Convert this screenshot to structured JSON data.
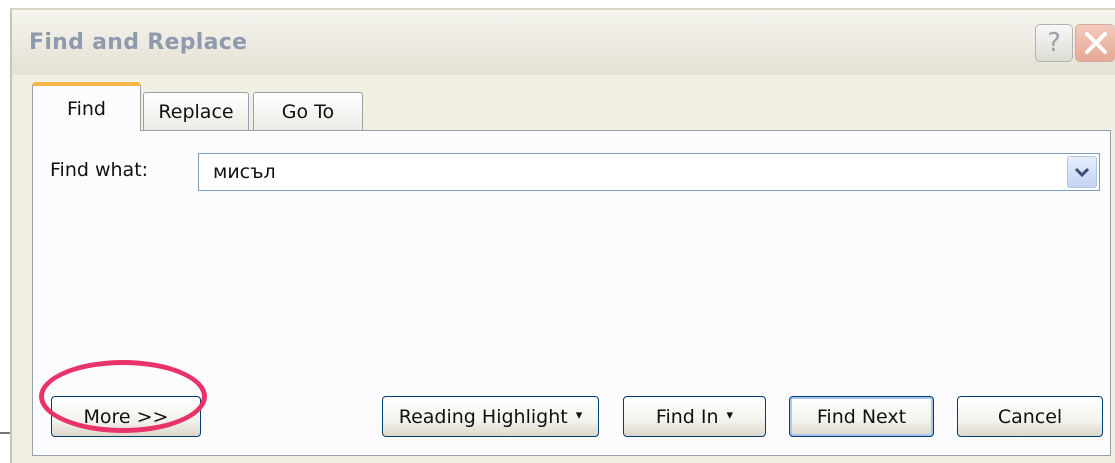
{
  "window": {
    "title": "Find and Replace",
    "help_icon": "help-icon",
    "close_icon": "close-icon"
  },
  "tabs": [
    {
      "label": "Find",
      "active": true
    },
    {
      "label": "Replace",
      "active": false
    },
    {
      "label": "Go To",
      "active": false
    }
  ],
  "find": {
    "label": "Find what:",
    "value": "мисъл",
    "dropdown_icon": "chevron-down-icon"
  },
  "buttons": {
    "more": "More >>",
    "reading_highlight": "Reading Highlight",
    "find_in": "Find In",
    "find_next": "Find Next",
    "cancel": "Cancel",
    "menu_caret": "▾"
  },
  "annotation": {
    "highlight_color": "#e8336b"
  },
  "colors": {
    "active_tab_accent": "#f6b64a",
    "title_text": "#8f9aac",
    "dialog_background": "#f1efe2"
  }
}
